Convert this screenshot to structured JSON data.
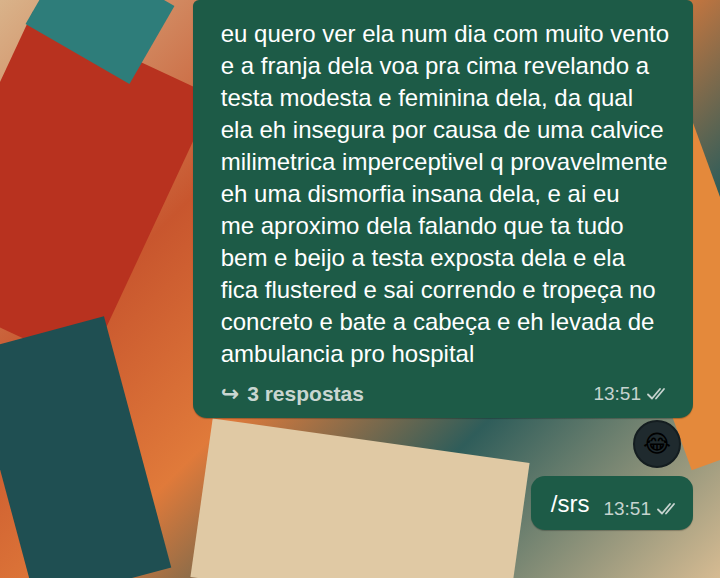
{
  "messages": [
    {
      "lines": [
        "eu quero ver ela num dia com muito vento",
        "e a franja dela voa pra cima revelando a",
        "testa modesta e feminina dela, da qual",
        "ela eh insegura por causa de uma calvice",
        "milimetrica imperceptivel q provavelmente",
        "eh uma dismorfia insana dela, e ai eu",
        "me aproximo dela falando que ta tudo",
        "bem e beijo a testa exposta dela e ela",
        "fica flustered e sai correndo e tropeça no",
        "concreto e bate a cabeça e eh levada de",
        "ambulancia pro hospital"
      ],
      "thread": {
        "icon": "↪",
        "label": "3 respostas"
      },
      "time": "13:51",
      "read": false,
      "reaction": "😂"
    },
    {
      "lines": [
        "/srs"
      ],
      "time": "13:51",
      "read": false
    }
  ]
}
